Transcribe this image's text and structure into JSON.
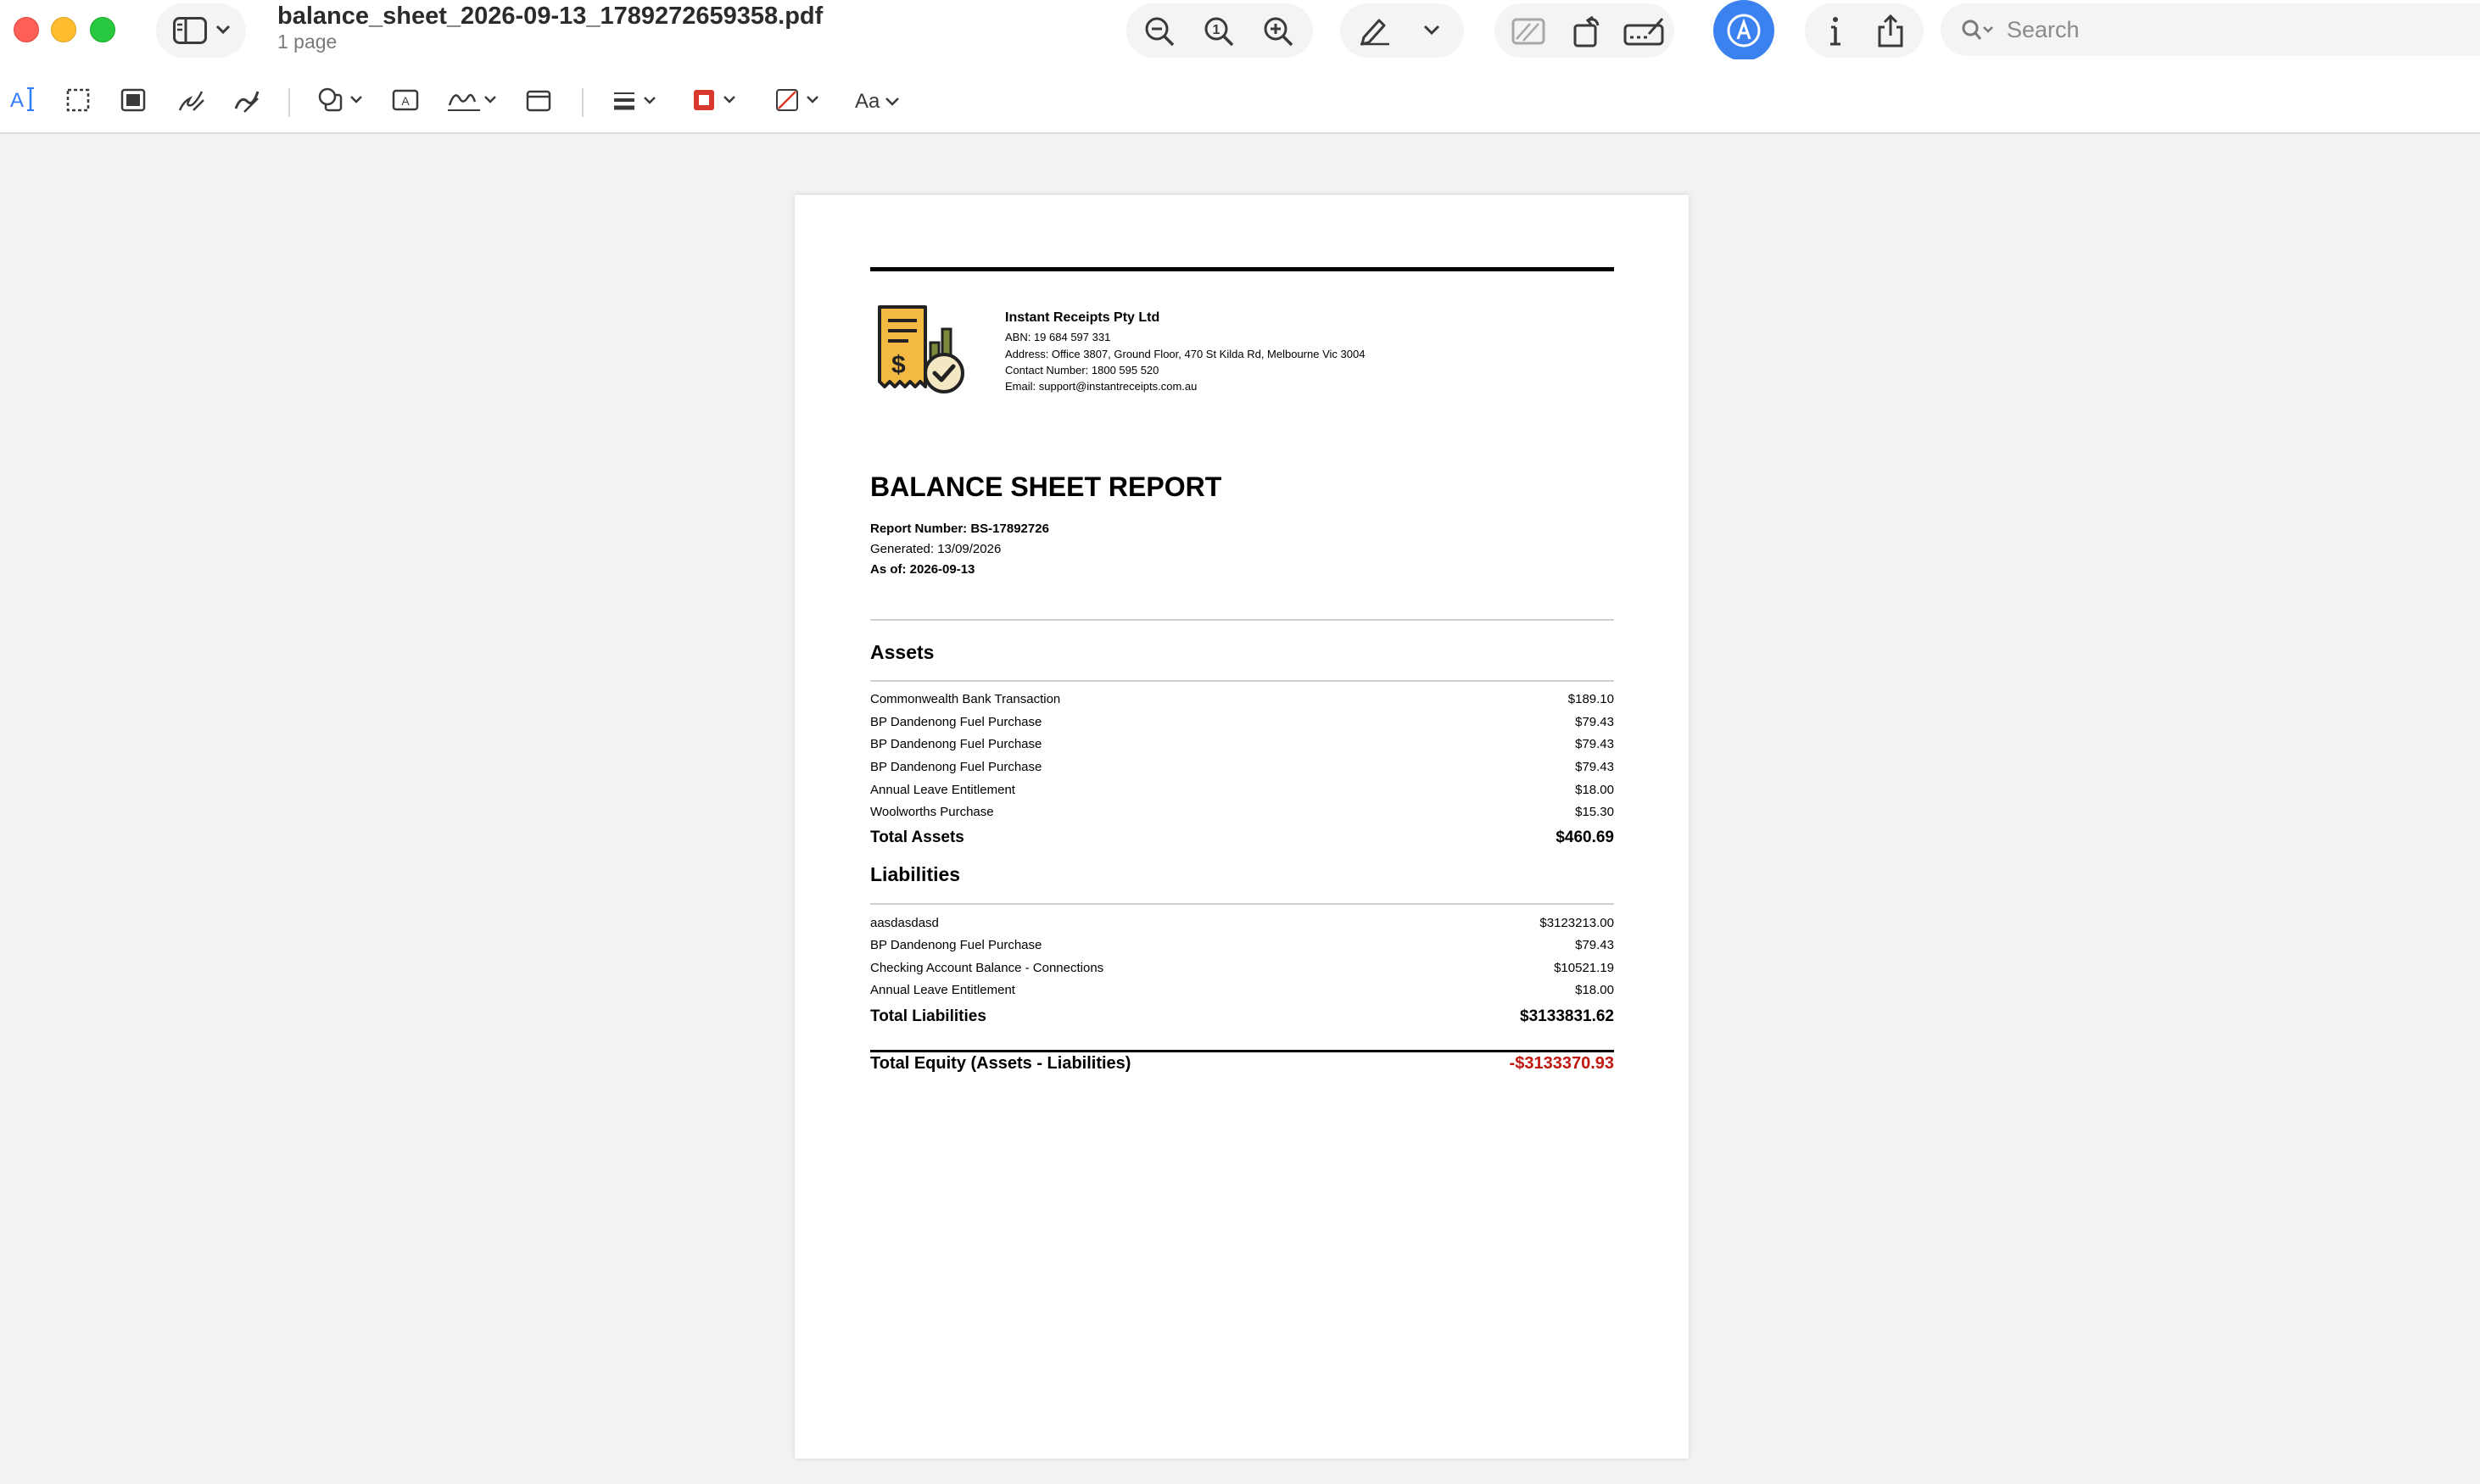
{
  "window": {
    "title": "balance_sheet_2026-09-13_1789272659358.pdf",
    "subtitle": "1 page"
  },
  "toolbar": {
    "search_placeholder": "Search",
    "icons": [
      "sidebar-icon",
      "zoom-out-icon",
      "actual-size-icon",
      "zoom-in-icon",
      "highlight-pen-icon",
      "chevron-down-icon",
      "redact-icon",
      "rotate-icon",
      "markup-signature-icon",
      "markup-toolbar-icon",
      "info-icon",
      "share-icon",
      "search-icon"
    ]
  },
  "markup_toolbar": {
    "icons": [
      "text-selection-icon",
      "rectangular-selection-icon",
      "redact-selection-icon",
      "sketch-icon",
      "draw-icon",
      "shapes-icon",
      "text-box-icon",
      "sign-icon",
      "note-icon",
      "shape-style-icon",
      "border-color-icon",
      "fill-color-icon",
      "text-style-icon"
    ],
    "text_style_label": "Aa",
    "border_color": "#d9382c",
    "fill_color": "#d9382c"
  },
  "document": {
    "company": {
      "name": "Instant Receipts Pty Ltd",
      "abn": "ABN: 19 684 597 331",
      "address": "Address: Office 3807, Ground Floor, 470 St Kilda Rd, Melbourne Vic 3004",
      "contact": "Contact Number: 1800 595 520",
      "email": "Email: support@instantreceipts.com.au"
    },
    "title": "BALANCE SHEET REPORT",
    "report_number": "Report Number: BS-17892726",
    "generated": "Generated: 13/09/2026",
    "as_of": "As of: 2026-09-13",
    "assets": {
      "heading": "Assets",
      "items": [
        {
          "label": "Commonwealth Bank Transaction",
          "amount": "$189.10"
        },
        {
          "label": "BP Dandenong Fuel Purchase",
          "amount": "$79.43"
        },
        {
          "label": "BP Dandenong Fuel Purchase",
          "amount": "$79.43"
        },
        {
          "label": "BP Dandenong Fuel Purchase",
          "amount": "$79.43"
        },
        {
          "label": "Annual Leave Entitlement",
          "amount": "$18.00"
        },
        {
          "label": "Woolworths Purchase",
          "amount": "$15.30"
        }
      ],
      "total_label": "Total Assets",
      "total_amount": "$460.69"
    },
    "liabilities": {
      "heading": "Liabilities",
      "items": [
        {
          "label": "aasdasdasd",
          "amount": "$3123213.00"
        },
        {
          "label": "BP Dandenong Fuel Purchase",
          "amount": "$79.43"
        },
        {
          "label": "Checking Account Balance - Connections",
          "amount": "$10521.19"
        },
        {
          "label": "Annual Leave Entitlement",
          "amount": "$18.00"
        }
      ],
      "total_label": "Total Liabilities",
      "total_amount": "$3133831.62"
    },
    "equity": {
      "label": "Total Equity (Assets - Liabilities)",
      "amount": "-$3133370.93",
      "amount_color": "#c0170f"
    }
  }
}
